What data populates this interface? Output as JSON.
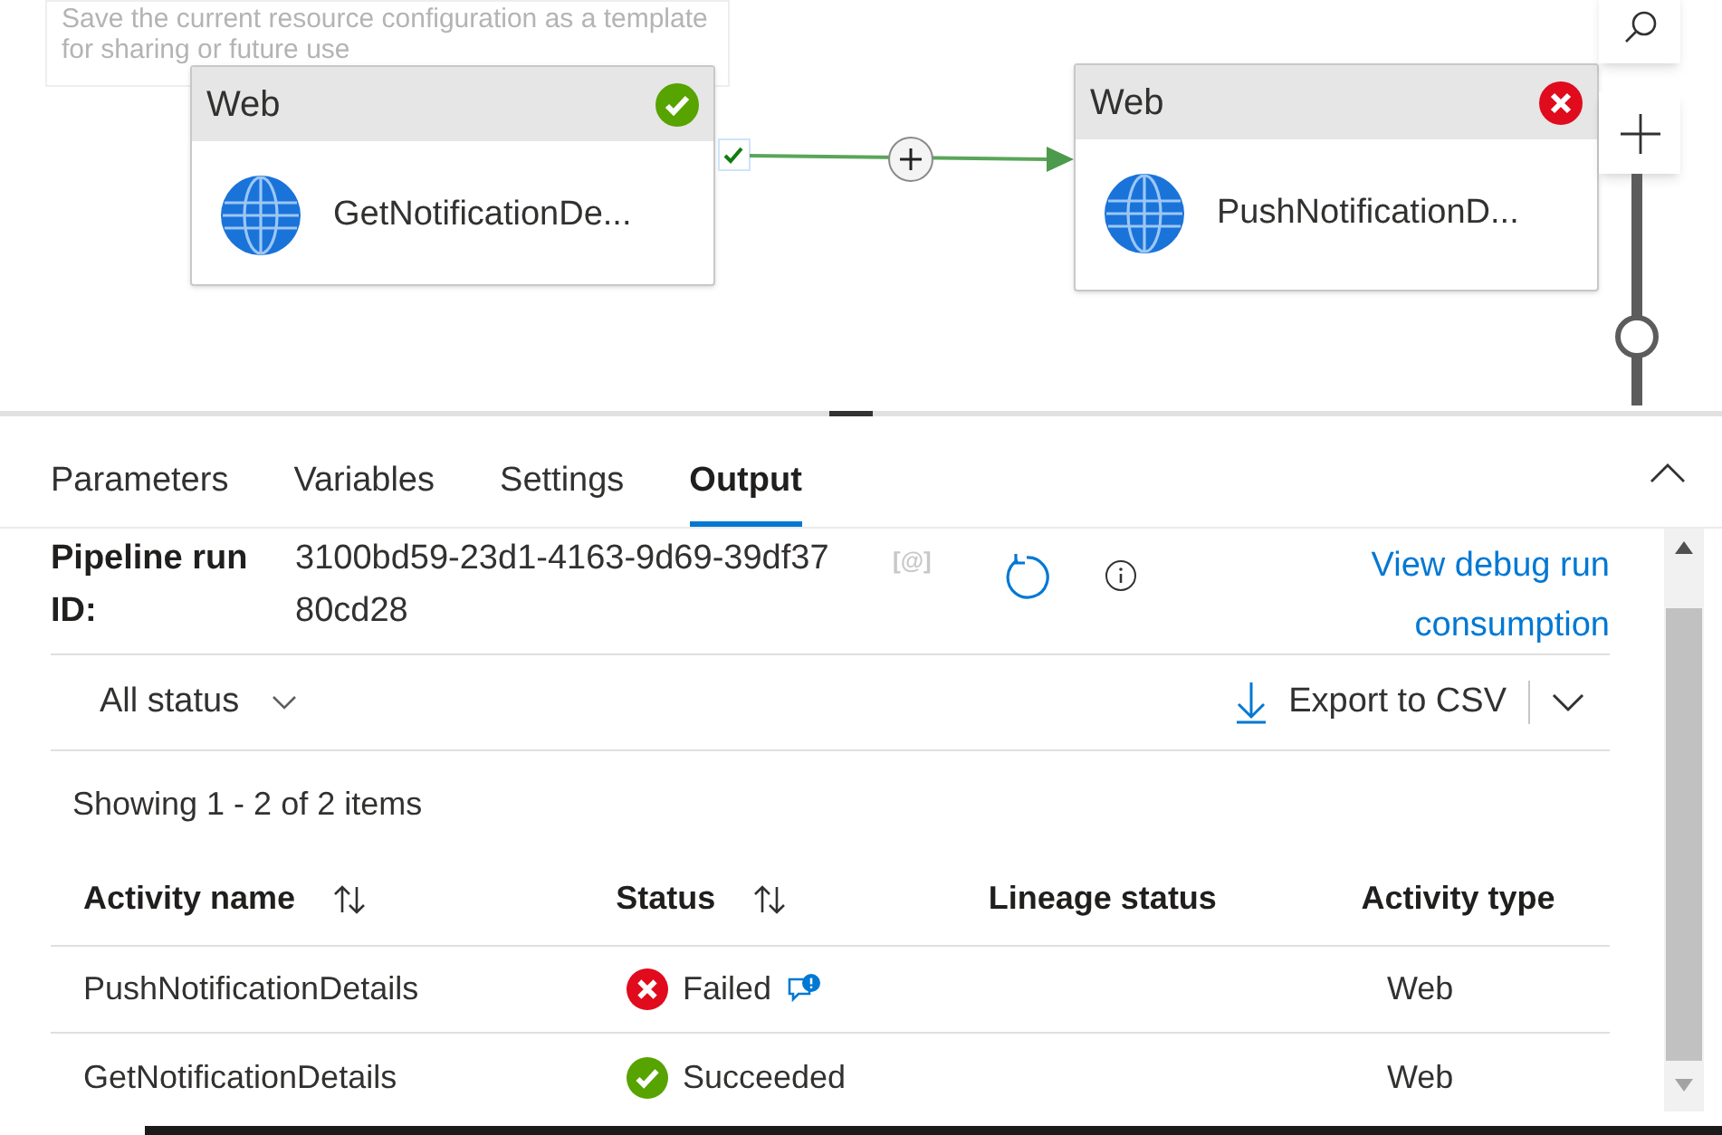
{
  "canvas": {
    "tooltip": "Save the current resource configuration as a template for sharing or future use",
    "nodes": [
      {
        "type": "Web",
        "name": "GetNotificationDe...",
        "failed": false
      },
      {
        "type": "Web",
        "name": "PushNotificationD...",
        "failed": true
      }
    ],
    "zoom": {
      "level": 0.3
    }
  },
  "tabs": [
    {
      "label": "Parameters",
      "selected": false
    },
    {
      "label": "Variables",
      "selected": false
    },
    {
      "label": "Settings",
      "selected": false
    },
    {
      "label": "Output",
      "selected": true
    }
  ],
  "output": {
    "run_id_label": "Pipeline run ID:",
    "run_id": "3100bd59-23d1-4163-9d69-39df3780cd28",
    "mention": "[@]",
    "debug_link": "View debug run consumption",
    "filter": "All status",
    "export": "Export to CSV",
    "showing": "Showing 1 - 2 of 2 items",
    "table": {
      "columns": [
        {
          "label": "Activity name",
          "sortable": true
        },
        {
          "label": "Status",
          "sortable": true
        },
        {
          "label": "Lineage status",
          "sortable": false
        },
        {
          "label": "Activity type",
          "sortable": false
        }
      ],
      "rows": [
        {
          "activity_name": "PushNotificationDetails",
          "status": "Failed",
          "failed": true,
          "has_message": true,
          "activity_type": "Web"
        },
        {
          "activity_name": "GetNotificationDetails",
          "status": "Succeeded",
          "failed": false,
          "has_message": false,
          "activity_type": "Web"
        }
      ]
    }
  }
}
